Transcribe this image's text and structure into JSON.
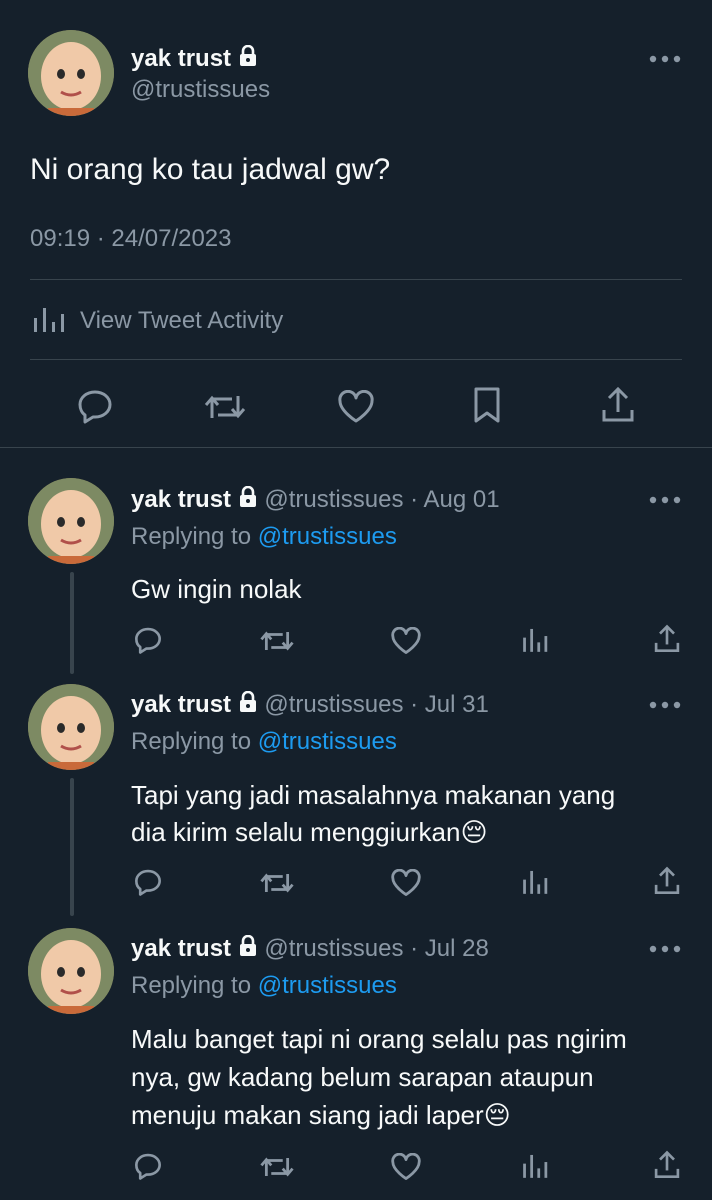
{
  "main_tweet": {
    "display_name": "yak trust",
    "handle": "@trustissues",
    "text": "Ni orang ko tau jadwal gw?",
    "timestamp": "09:19 · 24/07/2023",
    "activity_label": "View Tweet Activity"
  },
  "replies": [
    {
      "display_name": "yak trust",
      "handle": "@trustissues",
      "date": "· Aug 01",
      "replying_prefix": "Replying to",
      "replying_to": "@trustissues",
      "text_lines": [
        "Gw ingin nolak"
      ]
    },
    {
      "display_name": "yak trust",
      "handle": "@trustissues",
      "date": "· Jul 31",
      "replying_prefix": "Replying to",
      "replying_to": "@trustissues",
      "text_lines": [
        "Tapi yang jadi masalahnya makanan yang",
        "dia kirim selalu menggiurkan😔"
      ]
    },
    {
      "display_name": "yak trust",
      "handle": "@trustissues",
      "date": "· Jul 28",
      "replying_prefix": "Replying to",
      "replying_to": "@trustissues",
      "text_lines": [
        "Malu banget tapi ni orang selalu pas ngirim",
        "nya, gw kadang belum sarapan ataupun",
        "menuju makan siang jadi laper😔"
      ]
    }
  ],
  "colors": {
    "background": "#15202b",
    "text": "#f7f9f9",
    "muted": "#8b98a5",
    "link": "#1d9bf0",
    "divider": "#38444d"
  },
  "icons": [
    "lock-icon",
    "more-icon",
    "reply-icon",
    "retweet-icon",
    "like-icon",
    "bookmark-icon",
    "share-icon",
    "analytics-icon"
  ]
}
